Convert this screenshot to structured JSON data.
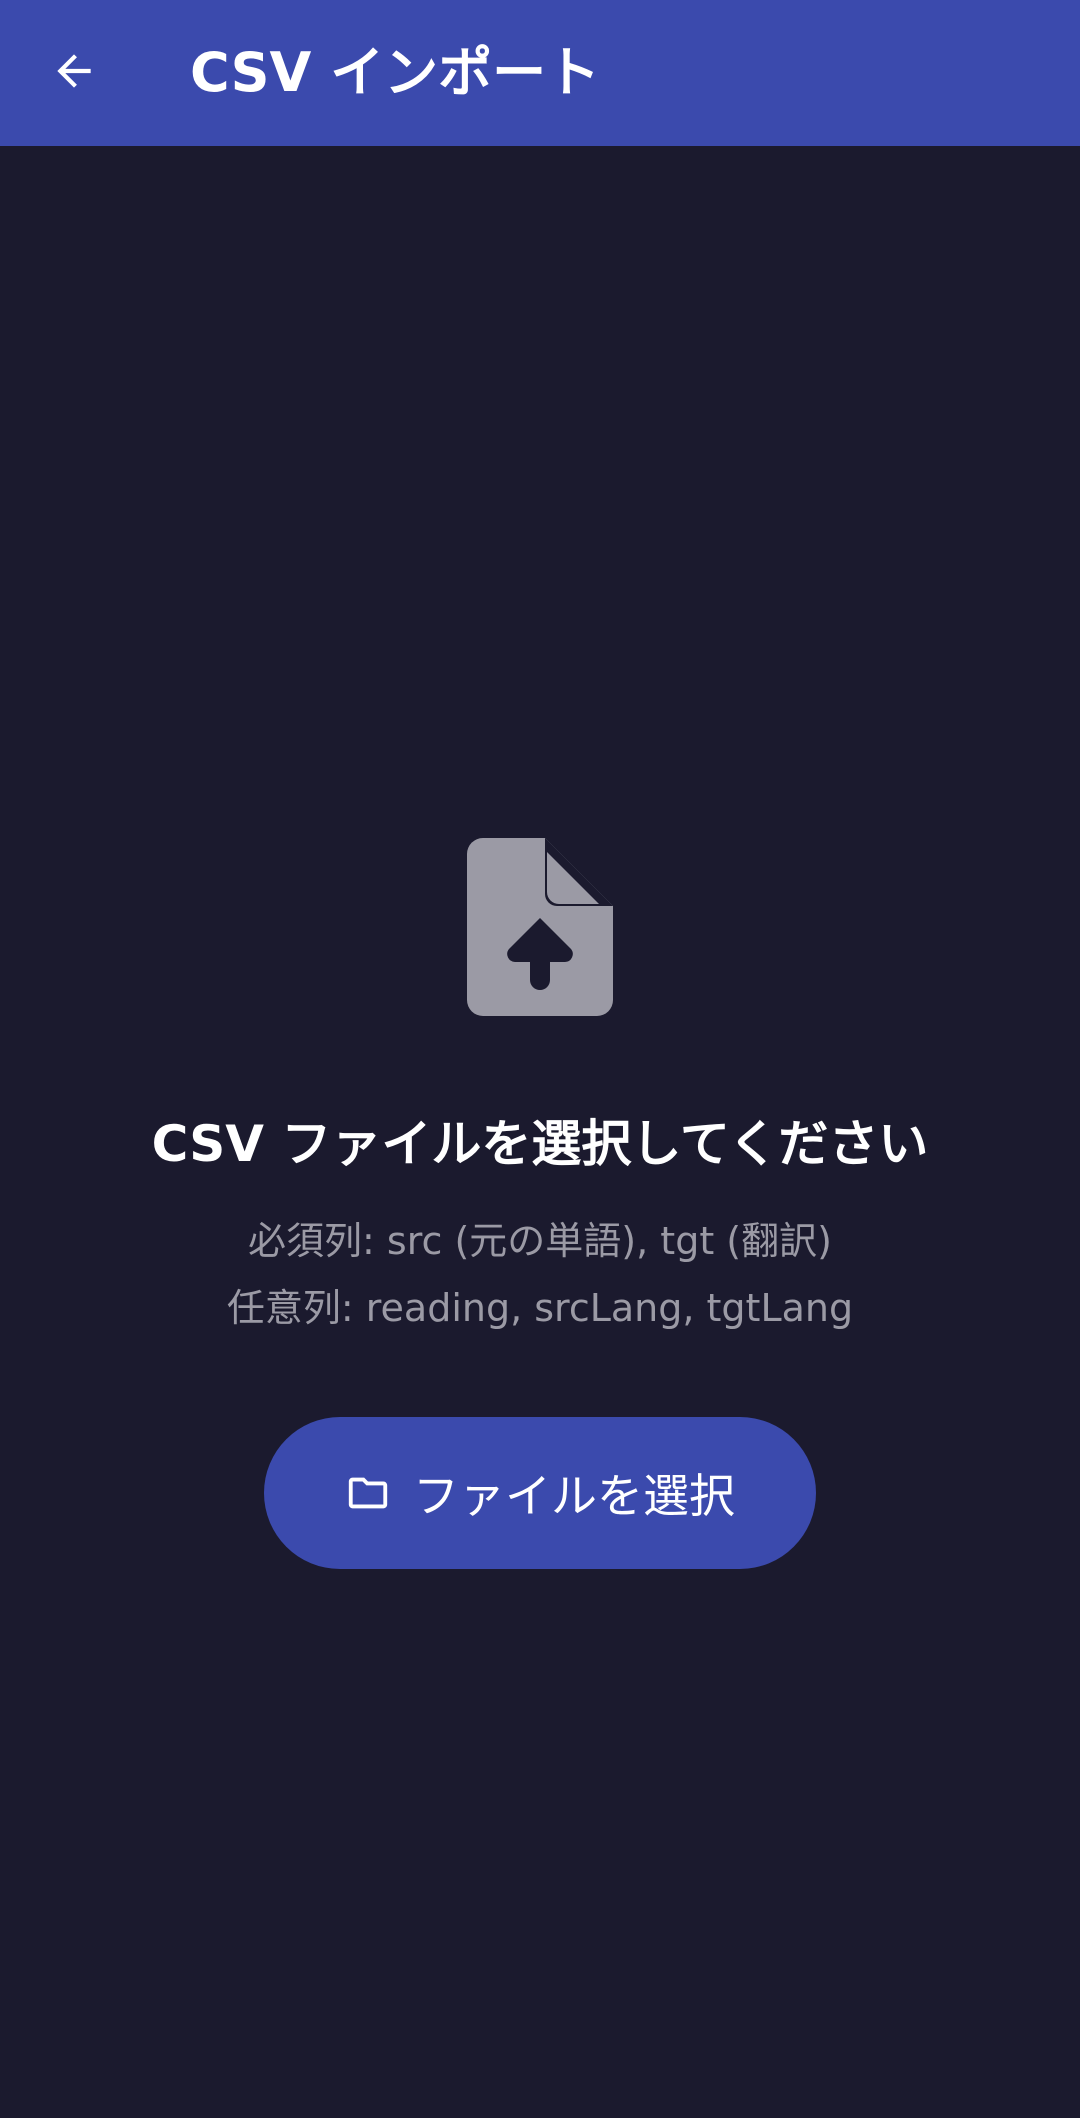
{
  "app_bar": {
    "title": "CSV インポート",
    "background_color": "#3b4aad",
    "back_icon": "arrow-back-icon"
  },
  "main": {
    "background_color": "#1b1a2e",
    "icon": "file-upload-icon",
    "icon_color": "#9b9aa5",
    "headline": "CSV ファイルを選択してください",
    "required_columns": "必須列: src (元の単語), tgt (翻訳)",
    "optional_columns": "任意列: reading, srcLang, tgtLang",
    "select_button": {
      "label": "ファイルを選択",
      "icon": "folder-icon",
      "color": "#3b4aad"
    }
  }
}
